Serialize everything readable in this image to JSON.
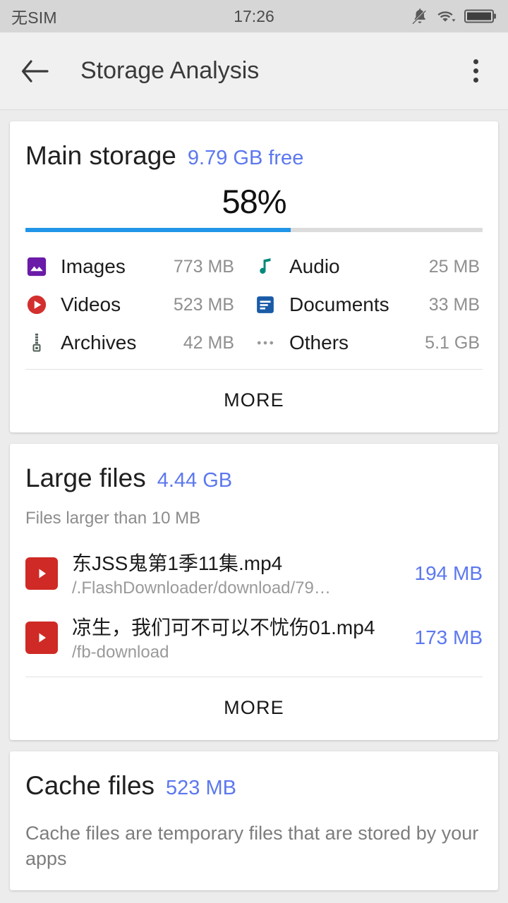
{
  "status_bar": {
    "carrier": "无SIM",
    "time": "17:26",
    "icons": [
      "bell-muted-icon",
      "wifi-icon",
      "battery-full-icon"
    ]
  },
  "app_bar": {
    "back_icon": "back-arrow-icon",
    "title": "Storage Analysis",
    "overflow_icon": "more-vertical-icon"
  },
  "main_storage": {
    "title": "Main storage",
    "free": "9.79 GB free",
    "percent_label": "58%",
    "percent_value": 58,
    "bar_color": "#2196e8",
    "accent_color": "#5c78ef",
    "categories": [
      {
        "icon": "image-icon",
        "label": "Images",
        "size": "773 MB",
        "color": "#6A1BA8"
      },
      {
        "icon": "audio-icon",
        "label": "Audio",
        "size": "25 MB",
        "color": "#00897B"
      },
      {
        "icon": "video-icon",
        "label": "Videos",
        "size": "523 MB",
        "color": "#D32F2F"
      },
      {
        "icon": "document-icon",
        "label": "Documents",
        "size": "33 MB",
        "color": "#1A5BA8"
      },
      {
        "icon": "archive-icon",
        "label": "Archives",
        "size": "42 MB",
        "color": "#4F5F57"
      },
      {
        "icon": "others-icon",
        "label": "Others",
        "size": "5.1 GB",
        "color": "#9a9a9a"
      }
    ],
    "more_label": "MORE"
  },
  "large_files": {
    "title": "Large files",
    "total": "4.44 GB",
    "subtitle": "Files larger than 10 MB",
    "files": [
      {
        "icon": "video-file-icon",
        "name": "东JSS鬼第1季11集.mp4",
        "path": "/.FlashDownloader/download/79…",
        "size": "194 MB"
      },
      {
        "icon": "video-file-icon",
        "name": "凉生，我们可不可以不忧伤01.mp4",
        "path": "/fb-download",
        "size": "173 MB"
      }
    ],
    "more_label": "MORE"
  },
  "cache_files": {
    "title": "Cache files",
    "total": "523 MB",
    "description": "Cache files are temporary files that are stored by your apps"
  }
}
